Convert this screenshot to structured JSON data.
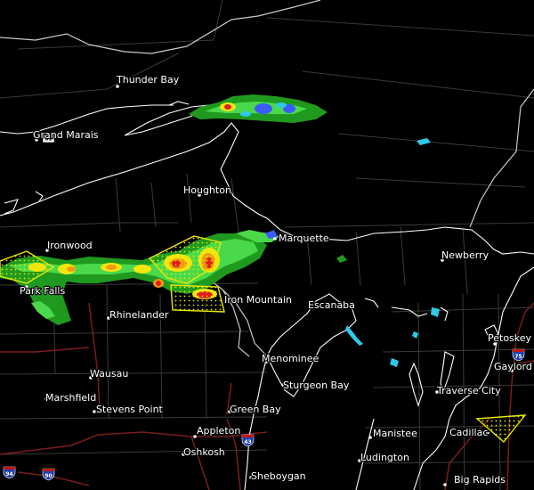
{
  "colors": {
    "background": "#000000",
    "shoreline": "#ffffff",
    "state_border": "#d8d8d8",
    "county_line": "#3c3c3c",
    "highway": "#7a1c1c",
    "warning_polygon": "#e8e800",
    "radar_light_green": "#4ad94a",
    "radar_green": "#1f9a1f",
    "radar_yellow": "#f2e60f",
    "radar_orange": "#f29a0f",
    "radar_red": "#e01e1e",
    "radar_blue": "#3a5cff",
    "radar_cyan": "#30c8e8"
  },
  "cities": [
    {
      "name": "Thunder Bay"
    },
    {
      "name": "Grand Marais"
    },
    {
      "name": "Houghton"
    },
    {
      "name": "Marquette"
    },
    {
      "name": "Newberry"
    },
    {
      "name": "Ironwood"
    },
    {
      "name": "Park Falls"
    },
    {
      "name": "Rhinelander"
    },
    {
      "name": "Iron Mountain"
    },
    {
      "name": "Escanaba"
    },
    {
      "name": "Petoskey"
    },
    {
      "name": "Gaylord"
    },
    {
      "name": "Menominee"
    },
    {
      "name": "Wausau"
    },
    {
      "name": "Sturgeon Bay"
    },
    {
      "name": "Traverse City"
    },
    {
      "name": "Marshfield"
    },
    {
      "name": "Stevens Point"
    },
    {
      "name": "Green Bay"
    },
    {
      "name": "Appleton"
    },
    {
      "name": "Cadillac"
    },
    {
      "name": "Manistee"
    },
    {
      "name": "Oshkosh"
    },
    {
      "name": "Ludington"
    },
    {
      "name": "Sheboygan"
    },
    {
      "name": "Big Rapids"
    }
  ],
  "highway_shields": [
    {
      "route": "61",
      "type": "us"
    },
    {
      "route": "75",
      "type": "interstate"
    },
    {
      "route": "43",
      "type": "interstate"
    },
    {
      "route": "94",
      "type": "interstate"
    },
    {
      "route": "90",
      "type": "interstate"
    }
  ]
}
